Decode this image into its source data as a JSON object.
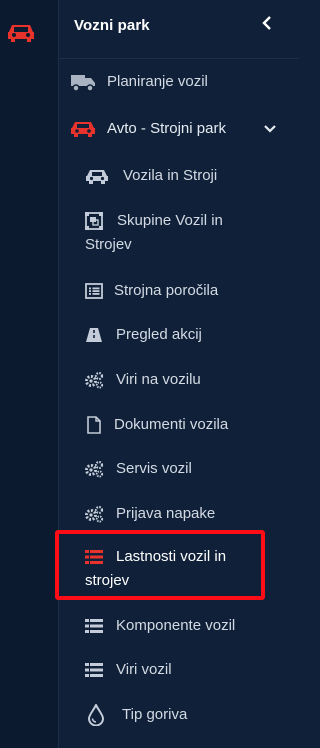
{
  "header": {
    "title": "Vozni park"
  },
  "menu": {
    "planiranje": "Planiranje vozil",
    "avto_strojni": "Avto - Strojni park",
    "vozila": "Vozila in Stroji",
    "skupine_1": "Skupine Vozil in",
    "skupine_2": "Strojev",
    "porocila": "Strojna poročila",
    "pregled": "Pregled akcij",
    "viri_na_vozilu": "Viri na vozilu",
    "dokumenti": "Dokumenti vozila",
    "servis": "Servis vozil",
    "prijava": "Prijava napake",
    "lastnosti_1": "Lastnosti vozil in",
    "lastnosti_2": "strojev",
    "komponente": "Komponente vozil",
    "viri_vozil": "Viri vozil",
    "tip_goriva": "Tip goriva"
  },
  "colors": {
    "background": "#0f2038",
    "rail": "#0c1a2f",
    "accent_red": "#e8332c",
    "highlight_border": "#ff0d16",
    "text": "#d3dae3"
  }
}
